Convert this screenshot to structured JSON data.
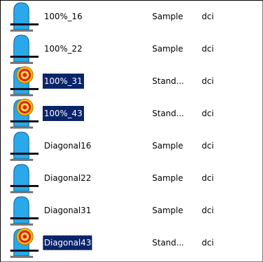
{
  "files": [
    {
      "name": "100%_16",
      "type": "Sample",
      "ext": "dci",
      "icon": "sample-icon",
      "selected": false
    },
    {
      "name": "100%_22",
      "type": "Sample",
      "ext": "dci",
      "icon": "sample-icon",
      "selected": false
    },
    {
      "name": "100%_31",
      "type": "Stand...",
      "ext": "dci",
      "icon": "standard-icon",
      "selected": true
    },
    {
      "name": "100%_43",
      "type": "Stand...",
      "ext": "dci",
      "icon": "standard-icon",
      "selected": true
    },
    {
      "name": "Diagonal16",
      "type": "Sample",
      "ext": "dci",
      "icon": "sample-icon",
      "selected": false
    },
    {
      "name": "Diagonal22",
      "type": "Sample",
      "ext": "dci",
      "icon": "sample-icon",
      "selected": false
    },
    {
      "name": "Diagonal31",
      "type": "Sample",
      "ext": "dci",
      "icon": "sample-icon",
      "selected": false
    },
    {
      "name": "Diagonal43",
      "type": "Stand...",
      "ext": "dci",
      "icon": "standard-icon",
      "selected": true,
      "focused": true
    }
  ]
}
